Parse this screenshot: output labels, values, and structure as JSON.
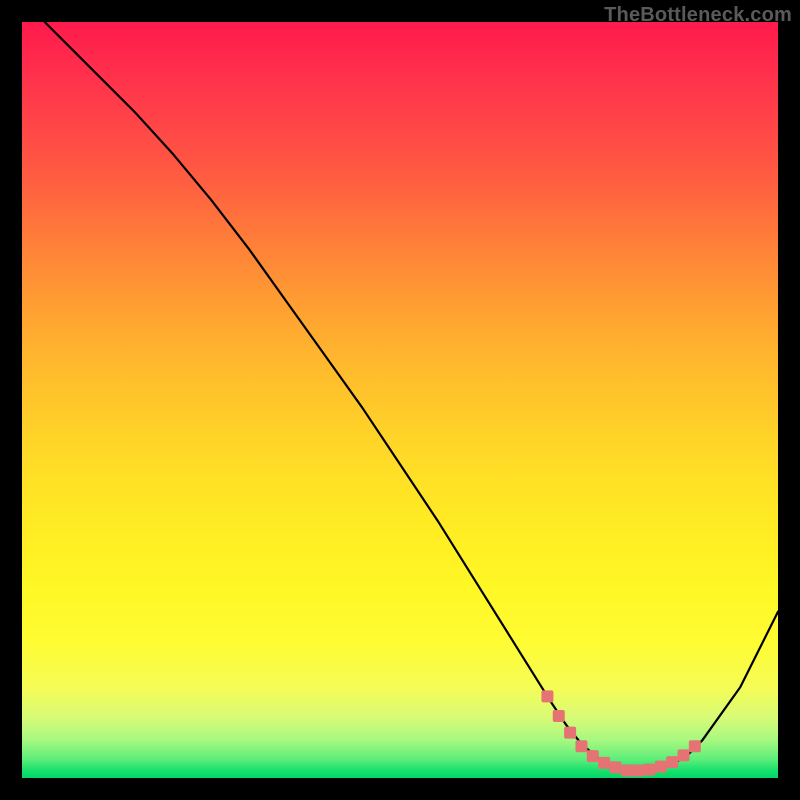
{
  "watermark": "TheBottleneck.com",
  "chart_data": {
    "type": "line",
    "title": "",
    "xlabel": "",
    "ylabel": "",
    "xlim": [
      0,
      100
    ],
    "ylim": [
      0,
      100
    ],
    "grid": false,
    "legend": false,
    "series": [
      {
        "name": "bottleneck-curve",
        "color": "#000000",
        "x": [
          3,
          6,
          10,
          15,
          20,
          25,
          30,
          35,
          40,
          45,
          50,
          55,
          60,
          65,
          70,
          72,
          74,
          76,
          78,
          80,
          82,
          84,
          86,
          88,
          90,
          95,
          100
        ],
        "y": [
          100,
          97,
          93,
          88,
          82.5,
          76.5,
          70,
          63,
          56,
          49,
          41.5,
          34,
          26,
          18,
          10,
          7,
          4.5,
          2.8,
          1.6,
          1.0,
          1.0,
          1.2,
          1.8,
          3.0,
          5,
          12,
          22
        ]
      }
    ],
    "markers": {
      "name": "optimal-range",
      "color": "#e57373",
      "x": [
        69.5,
        71,
        72.5,
        74,
        75.5,
        77,
        78.5,
        80,
        81.5,
        83,
        84.5,
        86,
        87.5,
        89
      ],
      "y": [
        10.8,
        8.2,
        6.0,
        4.2,
        2.9,
        2.0,
        1.4,
        1.0,
        1.0,
        1.1,
        1.5,
        2.1,
        3.0,
        4.2
      ]
    }
  }
}
